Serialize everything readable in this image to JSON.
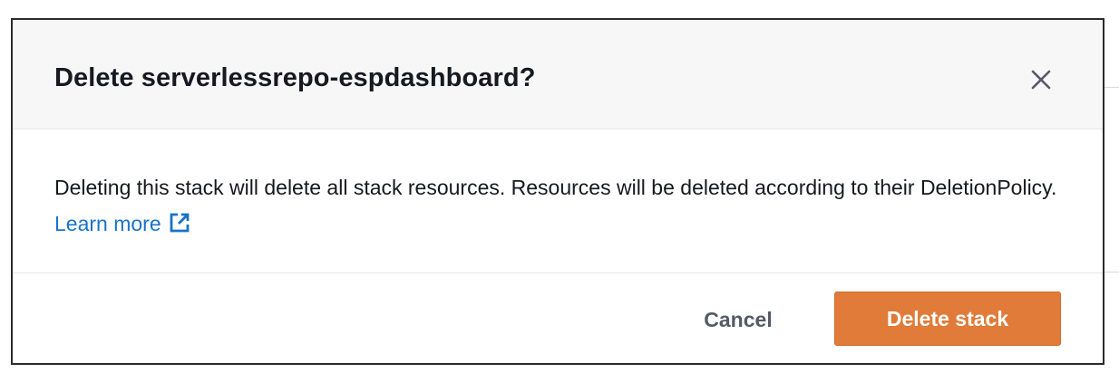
{
  "modal": {
    "title": "Delete serverlessrepo-espdashboard?",
    "close_icon": "close-icon",
    "body_text": "Deleting this stack will delete all stack resources. Resources will be deleted according to their DeletionPolicy.",
    "learn_more_label": "Learn more",
    "learn_more_icon": "external-link-icon",
    "cancel_label": "Cancel",
    "delete_label": "Delete stack"
  },
  "colors": {
    "primary_button": "#e07b39",
    "link": "#1a73c8",
    "title_text": "#16191f",
    "header_background": "#f7f7f7"
  }
}
